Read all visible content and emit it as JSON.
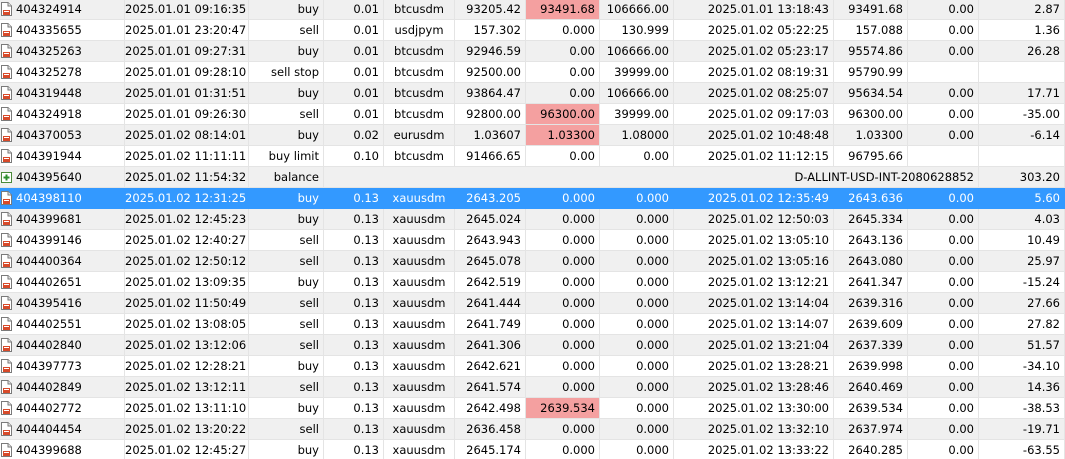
{
  "colors": {
    "selected_row": "#3399ff",
    "price_highlight": "#f4a0a0",
    "stripe": "#f0f0f0"
  },
  "icons": {
    "order": "order-doc-icon",
    "balance": "balance-plus-icon"
  },
  "rows": [
    {
      "ticket": "404324914",
      "time": "2025.01.01 09:16:35",
      "type": "buy",
      "volume": "0.01",
      "symbol": "btcusdm",
      "price": "93205.42",
      "sl": "93491.68",
      "tp": "106666.00",
      "close_time": "2025.01.01 13:18:43",
      "close_price": "93491.68",
      "commission": "0.00",
      "profit": "2.87",
      "sl_hl": true
    },
    {
      "ticket": "404335655",
      "time": "2025.01.01 23:20:47",
      "type": "sell",
      "volume": "0.01",
      "symbol": "usdjpym",
      "price": "157.302",
      "sl": "0.000",
      "tp": "130.999",
      "close_time": "2025.01.02 05:22:25",
      "close_price": "157.088",
      "commission": "0.00",
      "profit": "1.36"
    },
    {
      "ticket": "404325263",
      "time": "2025.01.01 09:27:31",
      "type": "buy",
      "volume": "0.01",
      "symbol": "btcusdm",
      "price": "92946.59",
      "sl": "0.00",
      "tp": "106666.00",
      "close_time": "2025.01.02 05:23:17",
      "close_price": "95574.86",
      "commission": "0.00",
      "profit": "26.28"
    },
    {
      "ticket": "404325278",
      "time": "2025.01.01 09:28:10",
      "type": "sell stop",
      "volume": "0.01",
      "symbol": "btcusdm",
      "price": "92500.00",
      "sl": "0.00",
      "tp": "39999.00",
      "close_time": "2025.01.02 08:19:31",
      "close_price": "95790.99",
      "commission": "",
      "profit": ""
    },
    {
      "ticket": "404319448",
      "time": "2025.01.01 01:31:51",
      "type": "buy",
      "volume": "0.01",
      "symbol": "btcusdm",
      "price": "93864.47",
      "sl": "0.00",
      "tp": "106666.00",
      "close_time": "2025.01.02 08:25:07",
      "close_price": "95634.54",
      "commission": "0.00",
      "profit": "17.71"
    },
    {
      "ticket": "404324918",
      "time": "2025.01.01 09:26:30",
      "type": "sell",
      "volume": "0.01",
      "symbol": "btcusdm",
      "price": "92800.00",
      "sl": "96300.00",
      "tp": "39999.00",
      "close_time": "2025.01.02 09:17:03",
      "close_price": "96300.00",
      "commission": "0.00",
      "profit": "-35.00",
      "sl_hl": true
    },
    {
      "ticket": "404370053",
      "time": "2025.01.02 08:14:01",
      "type": "buy",
      "volume": "0.02",
      "symbol": "eurusdm",
      "price": "1.03607",
      "sl": "1.03300",
      "tp": "1.08000",
      "close_time": "2025.01.02 10:48:48",
      "close_price": "1.03300",
      "commission": "0.00",
      "profit": "-6.14",
      "sl_hl": true
    },
    {
      "ticket": "404391944",
      "time": "2025.01.02 11:11:11",
      "type": "buy limit",
      "volume": "0.10",
      "symbol": "btcusdm",
      "price": "91466.65",
      "sl": "0.00",
      "tp": "0.00",
      "close_time": "2025.01.02 11:12:15",
      "close_price": "96795.66",
      "commission": "",
      "profit": ""
    },
    {
      "ticket": "404395640",
      "time": "2025.01.02 11:54:32",
      "type": "balance",
      "volume": "",
      "symbol": "",
      "price": "",
      "sl": "",
      "tp": "",
      "close_time": "",
      "close_price": "",
      "commission": "",
      "profit": "303.20",
      "comment": "D-ALLINT-USD-INT-2080628852",
      "balance": true
    },
    {
      "ticket": "404398110",
      "time": "2025.01.02 12:31:25",
      "type": "buy",
      "volume": "0.13",
      "symbol": "xauusdm",
      "price": "2643.205",
      "sl": "0.000",
      "tp": "0.000",
      "close_time": "2025.01.02 12:35:49",
      "close_price": "2643.636",
      "commission": "0.00",
      "profit": "5.60",
      "selected": true
    },
    {
      "ticket": "404399681",
      "time": "2025.01.02 12:45:23",
      "type": "buy",
      "volume": "0.13",
      "symbol": "xauusdm",
      "price": "2645.024",
      "sl": "0.000",
      "tp": "0.000",
      "close_time": "2025.01.02 12:50:03",
      "close_price": "2645.334",
      "commission": "0.00",
      "profit": "4.03"
    },
    {
      "ticket": "404399146",
      "time": "2025.01.02 12:40:27",
      "type": "sell",
      "volume": "0.13",
      "symbol": "xauusdm",
      "price": "2643.943",
      "sl": "0.000",
      "tp": "0.000",
      "close_time": "2025.01.02 13:05:10",
      "close_price": "2643.136",
      "commission": "0.00",
      "profit": "10.49"
    },
    {
      "ticket": "404400364",
      "time": "2025.01.02 12:50:12",
      "type": "sell",
      "volume": "0.13",
      "symbol": "xauusdm",
      "price": "2645.078",
      "sl": "0.000",
      "tp": "0.000",
      "close_time": "2025.01.02 13:05:16",
      "close_price": "2643.080",
      "commission": "0.00",
      "profit": "25.97"
    },
    {
      "ticket": "404402651",
      "time": "2025.01.02 13:09:35",
      "type": "buy",
      "volume": "0.13",
      "symbol": "xauusdm",
      "price": "2642.519",
      "sl": "0.000",
      "tp": "0.000",
      "close_time": "2025.01.02 13:12:21",
      "close_price": "2641.347",
      "commission": "0.00",
      "profit": "-15.24"
    },
    {
      "ticket": "404395416",
      "time": "2025.01.02 11:50:49",
      "type": "sell",
      "volume": "0.13",
      "symbol": "xauusdm",
      "price": "2641.444",
      "sl": "0.000",
      "tp": "0.000",
      "close_time": "2025.01.02 13:14:04",
      "close_price": "2639.316",
      "commission": "0.00",
      "profit": "27.66"
    },
    {
      "ticket": "404402551",
      "time": "2025.01.02 13:08:05",
      "type": "sell",
      "volume": "0.13",
      "symbol": "xauusdm",
      "price": "2641.749",
      "sl": "0.000",
      "tp": "0.000",
      "close_time": "2025.01.02 13:14:07",
      "close_price": "2639.609",
      "commission": "0.00",
      "profit": "27.82"
    },
    {
      "ticket": "404402840",
      "time": "2025.01.02 13:12:06",
      "type": "sell",
      "volume": "0.13",
      "symbol": "xauusdm",
      "price": "2641.306",
      "sl": "0.000",
      "tp": "0.000",
      "close_time": "2025.01.02 13:21:04",
      "close_price": "2637.339",
      "commission": "0.00",
      "profit": "51.57"
    },
    {
      "ticket": "404397773",
      "time": "2025.01.02 12:28:21",
      "type": "buy",
      "volume": "0.13",
      "symbol": "xauusdm",
      "price": "2642.621",
      "sl": "0.000",
      "tp": "0.000",
      "close_time": "2025.01.02 13:28:21",
      "close_price": "2639.998",
      "commission": "0.00",
      "profit": "-34.10"
    },
    {
      "ticket": "404402849",
      "time": "2025.01.02 13:12:11",
      "type": "sell",
      "volume": "0.13",
      "symbol": "xauusdm",
      "price": "2641.574",
      "sl": "0.000",
      "tp": "0.000",
      "close_time": "2025.01.02 13:28:46",
      "close_price": "2640.469",
      "commission": "0.00",
      "profit": "14.36"
    },
    {
      "ticket": "404402772",
      "time": "2025.01.02 13:11:10",
      "type": "buy",
      "volume": "0.13",
      "symbol": "xauusdm",
      "price": "2642.498",
      "sl": "2639.534",
      "tp": "0.000",
      "close_time": "2025.01.02 13:30:00",
      "close_price": "2639.534",
      "commission": "0.00",
      "profit": "-38.53",
      "sl_hl": true
    },
    {
      "ticket": "404404454",
      "time": "2025.01.02 13:20:22",
      "type": "sell",
      "volume": "0.13",
      "symbol": "xauusdm",
      "price": "2636.458",
      "sl": "0.000",
      "tp": "0.000",
      "close_time": "2025.01.02 13:32:10",
      "close_price": "2637.974",
      "commission": "0.00",
      "profit": "-19.71"
    },
    {
      "ticket": "404399688",
      "time": "2025.01.02 12:45:27",
      "type": "buy",
      "volume": "0.13",
      "symbol": "xauusdm",
      "price": "2645.174",
      "sl": "0.000",
      "tp": "0.000",
      "close_time": "2025.01.02 13:33:22",
      "close_price": "2640.285",
      "commission": "0.00",
      "profit": "-63.55"
    }
  ]
}
